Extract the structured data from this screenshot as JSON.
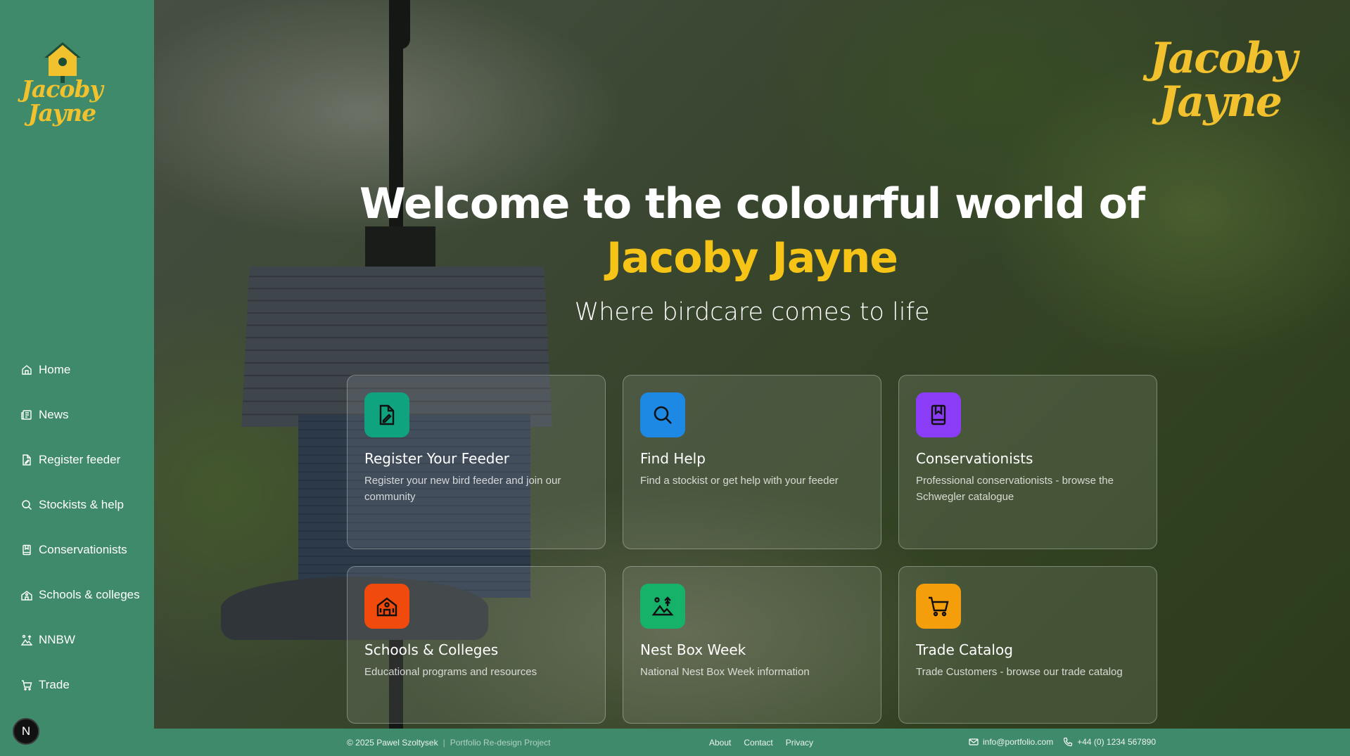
{
  "sidebar": {
    "logo_line1": "Jacoby",
    "logo_line2": "Jayne",
    "items": [
      {
        "label": "Home",
        "icon": "home-icon"
      },
      {
        "label": "News",
        "icon": "newspaper-icon"
      },
      {
        "label": "Register feeder",
        "icon": "file-pen-icon"
      },
      {
        "label": "Stockists & help",
        "icon": "search-icon"
      },
      {
        "label": "Conservationists",
        "icon": "book-icon"
      },
      {
        "label": "Schools & colleges",
        "icon": "school-icon"
      },
      {
        "label": "NNBW",
        "icon": "nest-box-icon"
      },
      {
        "label": "Trade",
        "icon": "cart-icon"
      }
    ],
    "badge": "N"
  },
  "header": {
    "logo_line1": "Jacoby",
    "logo_line2": "Jayne"
  },
  "hero": {
    "headline": "Welcome to the colourful world of",
    "headline_accent": "Jacoby Jayne",
    "tagline": "Where birdcare comes to life"
  },
  "cards": [
    {
      "title": "Register Your Feeder",
      "desc": "Register your new bird feeder and join our community",
      "icon": "file-pen-icon",
      "color": "#10a37f"
    },
    {
      "title": "Find Help",
      "desc": "Find a stockist or get help with your feeder",
      "icon": "search-icon",
      "color": "#1e88e5"
    },
    {
      "title": "Conservationists",
      "desc": "Professional conservationists - browse the Schwegler catalogue",
      "icon": "book-icon",
      "color": "#8b3cf7"
    },
    {
      "title": "Schools & Colleges",
      "desc": "Educational programs and resources",
      "icon": "school-icon",
      "color": "#f04a0c"
    },
    {
      "title": "Nest Box Week",
      "desc": "National Nest Box Week information",
      "icon": "nest-box-icon",
      "color": "#17b26a"
    },
    {
      "title": "Trade Catalog",
      "desc": "Trade Customers - browse our trade catalog",
      "icon": "cart-icon",
      "color": "#f59e0b"
    }
  ],
  "footer": {
    "copyright": "© 2025 Pawel Szoltysek",
    "separator": "|",
    "project": "Portfolio Re-design Project",
    "links": [
      "About",
      "Contact",
      "Privacy"
    ],
    "email": "info@portfolio.com",
    "phone": "+44 (0) 1234 567890"
  },
  "colors": {
    "sidebar_bg": "#3e8a6a",
    "accent_yellow": "#f5c417"
  }
}
